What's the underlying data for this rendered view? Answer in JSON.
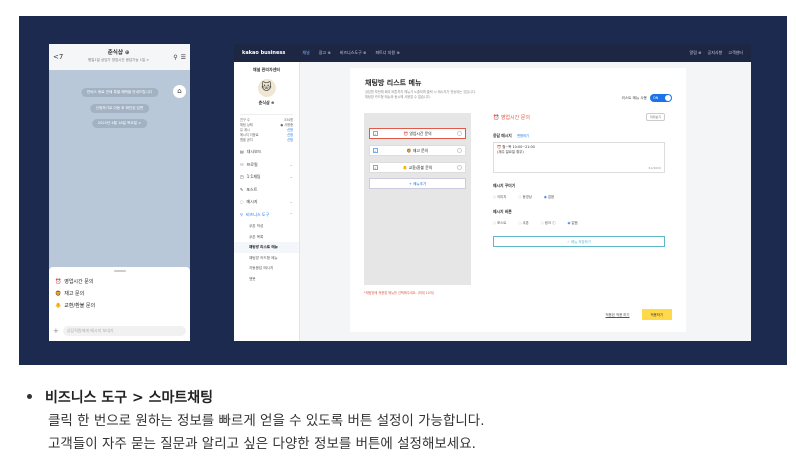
{
  "phone": {
    "back": "<7",
    "title": "춘식샵 ⊕",
    "subtitle": "평일1일 상담가 영업시간 응답가능 1일 >",
    "pills": [
      "반비스 종료 전에 특별 혜택을 안내드립니다",
      "신청하기로 이동 후 확인된 답변",
      "2025년 4월 18일 목요일 >"
    ],
    "home_icon": "⌂",
    "items": [
      {
        "icon": "⏰",
        "label": "영업시간 문의"
      },
      {
        "icon": "🦁",
        "label": "재고 문의"
      },
      {
        "icon": "🐥",
        "label": "교환/환불 문의"
      }
    ],
    "input_placeholder": "상담직원에게 메시지 보내기",
    "plus": "+"
  },
  "admin": {
    "topbar": {
      "logo": "kakao business",
      "nav": [
        "채널",
        "광고 ⊕",
        "비즈니스도구 ⊕",
        "파트너 지원 ⊕"
      ],
      "right": [
        "알림 ⊕",
        "공지사항",
        "고객센터"
      ]
    },
    "sidebar": {
      "title": "채널 관리자센터",
      "avatar": "🐱",
      "name": "춘식샵 ⊕",
      "stats": [
        {
          "k": "친구 수",
          "v": "334명"
        },
        {
          "k": "채팅 상태",
          "v": "● 사용중"
        },
        {
          "k": "유 계시",
          "v": "신청"
        },
        {
          "k": "메시지 이용료",
          "v": "신청"
        },
        {
          "k": "멤을 공지",
          "v": "신청"
        }
      ],
      "menu": [
        {
          "label": "대시보드",
          "type": "main"
        },
        {
          "label": "프로필",
          "type": "main"
        },
        {
          "label": "1:1채팅",
          "type": "main"
        },
        {
          "label": "포스트",
          "type": "main"
        },
        {
          "label": "메시지",
          "type": "main"
        },
        {
          "label": "비즈니스 도구",
          "type": "main"
        },
        {
          "label": "쿠폰 작성",
          "type": "sub"
        },
        {
          "label": "쿠폰 목록",
          "type": "sub"
        },
        {
          "label": "채팅방 리스트 메뉴",
          "type": "sub"
        },
        {
          "label": "채팅방 카드형 메뉴",
          "type": "sub"
        },
        {
          "label": "자동응답 메시지",
          "type": "sub"
        },
        {
          "label": "챗봇",
          "type": "sub"
        }
      ]
    },
    "page": {
      "title": "채팅방 리스트 메뉴",
      "desc1": "상담원 하단에 회여 버튼까지 메뉴가 노출되며 클릭 시 메시지가 전송되는 것입니다.",
      "desc2": "채팅방 카드형 메뉴와 동시에 사용할 수 없습니다.",
      "toggle_label": "리스트 메뉴 사용",
      "toggle_value": "ON",
      "list_items": [
        {
          "icon": "⏰",
          "label": "영업시간 문의"
        },
        {
          "icon": "🦁",
          "label": "재고 문의"
        },
        {
          "icon": "🐥",
          "label": "교환/환불 문의"
        }
      ],
      "add_label": "+ 메뉴추가",
      "warning": "*채팅방에 적용할 메뉴를 선택해주세요. (최대 10개)",
      "detail": {
        "title": "⏰ 영업시간 문의",
        "preview": "미리보기",
        "reply_label": "응답 메시지",
        "reply_link": "변형하기",
        "reply_text1": "⏰ 월~목 10:00~21:00",
        "reply_text2": "(재주 일요일 휴무)",
        "count": "61/4000",
        "button_label": "메시지 꾸미기",
        "button_opts": [
          "이미지",
          "동영상",
          "없음"
        ],
        "button_sel": 2,
        "link_label": "메시지 버튼",
        "link_opts": [
          "포스트",
          "쿠폰",
          "링크 ⓘ",
          "없음"
        ],
        "link_sel": 3,
        "save": "✓ 메뉴 저장하기"
      },
      "footer_link": "적용된 적용 하기",
      "apply": "적용하기"
    }
  },
  "caption": {
    "heading": "비즈니스 도구 > 스마트채팅",
    "line1": "클릭 한 번으로 원하는 정보를 빠르게 얻을 수 있도록 버튼 설정이 가능합니다.",
    "line2": "고객들이 자주 묻는 질문과 알리고 싶은 다양한 정보를 버튼에 설정해보세요."
  }
}
